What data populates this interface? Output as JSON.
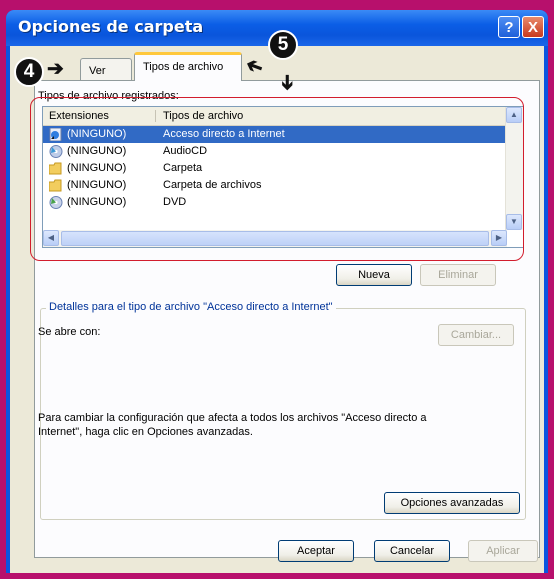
{
  "window": {
    "title": "Opciones de carpeta",
    "help_label": "?",
    "close_label": "X"
  },
  "tabs": [
    {
      "label": "Ver"
    },
    {
      "label": "Tipos de archivo"
    }
  ],
  "callouts": {
    "step_a": "4",
    "step_b": "5"
  },
  "registered_label": "Tipos de archivo registrados:",
  "file_types": {
    "columns": [
      "Extensiones",
      "Tipos de archivo"
    ],
    "rows": [
      {
        "ext": "(NINGUNO)",
        "type": "Acceso directo a Internet",
        "icon": "internet-shortcut-icon",
        "selected": true
      },
      {
        "ext": "(NINGUNO)",
        "type": "AudioCD",
        "icon": "audio-cd-icon"
      },
      {
        "ext": "(NINGUNO)",
        "type": "Carpeta",
        "icon": "folder-icon"
      },
      {
        "ext": "(NINGUNO)",
        "type": "Carpeta de archivos",
        "icon": "folder-icon"
      },
      {
        "ext": "(NINGUNO)",
        "type": "DVD",
        "icon": "dvd-icon"
      }
    ]
  },
  "buttons": {
    "new": "Nueva",
    "delete": "Eliminar",
    "change": "Cambiar...",
    "advanced": "Opciones avanzadas",
    "ok": "Aceptar",
    "cancel": "Cancelar",
    "apply": "Aplicar"
  },
  "details": {
    "legend": "Detalles para el tipo de archivo \"Acceso directo a Internet\"",
    "opens_with": "Se abre con:",
    "hint_line1": "Para cambiar la configuración que afecta a todos los archivos \"Acceso directo a",
    "hint_line2": "Internet\", haga clic en Opciones avanzadas."
  },
  "colors": {
    "selection": "#316ac5",
    "annotation_frame": "#d21d2d",
    "title_bar": "#0a55db"
  }
}
